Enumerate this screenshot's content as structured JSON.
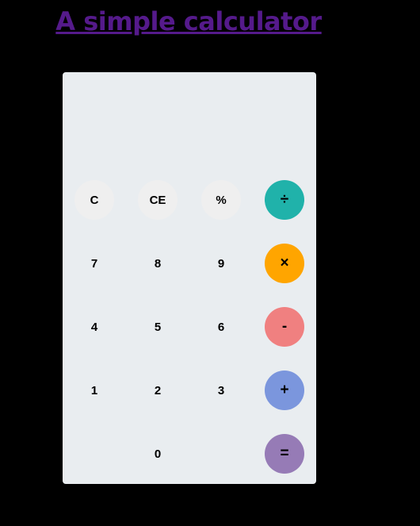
{
  "title": "A simple calculator",
  "display": {
    "value": ""
  },
  "buttons": {
    "clear": "C",
    "clear_entry": "CE",
    "percent": "%",
    "divide": "÷",
    "seven": "7",
    "eight": "8",
    "nine": "9",
    "multiply": "×",
    "four": "4",
    "five": "5",
    "six": "6",
    "subtract": "-",
    "one": "1",
    "two": "2",
    "three": "3",
    "add": "+",
    "zero": "0",
    "equals": "="
  },
  "colors": {
    "page_background": "#000000",
    "title_link": "#551a8b",
    "calculator_background": "#e9edf0",
    "function_button": "#efefef",
    "divide_button": "#20b2aa",
    "multiply_button": "#ffa500",
    "subtract_button": "#f08080",
    "add_button": "#7b96dd",
    "equals_button": "#967bb6"
  }
}
